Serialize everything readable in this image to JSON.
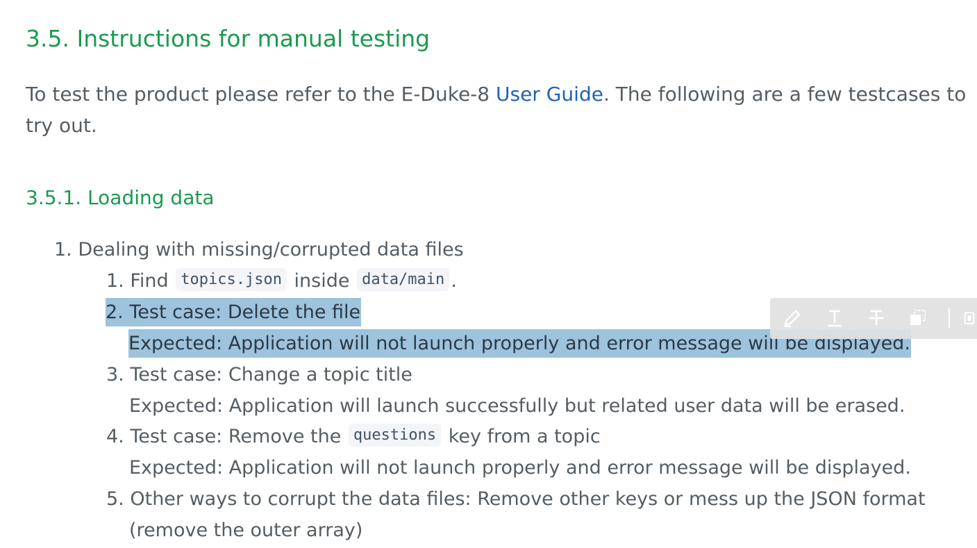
{
  "heading": "3.5. Instructions for manual testing",
  "intro": {
    "before": "To test the product please refer to the E-Duke-8 ",
    "link": "User Guide",
    "after": ". The following are a few testcases to try out."
  },
  "subheading": "3.5.1. Loading data",
  "outer_item": {
    "number": "1.",
    "text": "Dealing with missing/corrupted data files"
  },
  "steps": [
    {
      "number": "1.",
      "prefix": "Find ",
      "code1": "topics.json",
      "middle": " inside ",
      "code2": "data/main",
      "suffix": "."
    },
    {
      "number": "2.",
      "title": "Test case: Delete the file",
      "expected": "Expected: Application will not launch properly and error message will be displayed."
    },
    {
      "number": "3.",
      "title": "Test case: Change a topic title",
      "expected": "Expected: Application will launch successfully but related user data will be erased."
    },
    {
      "number": "4.",
      "prefix": "Test case: Remove the ",
      "code": "questions",
      "suffix": " key from a topic",
      "expected": "Expected: Application will not launch properly and error message will be displayed."
    },
    {
      "number": "5.",
      "line1": "Other ways to corrupt the data files: Remove other keys or mess up the JSON format",
      "line2": "(remove the outer array)"
    }
  ],
  "toolbar": {
    "icons": [
      "pencil-icon",
      "underline-icon",
      "strikethrough-icon",
      "copy-icon",
      "clip-icon"
    ]
  }
}
